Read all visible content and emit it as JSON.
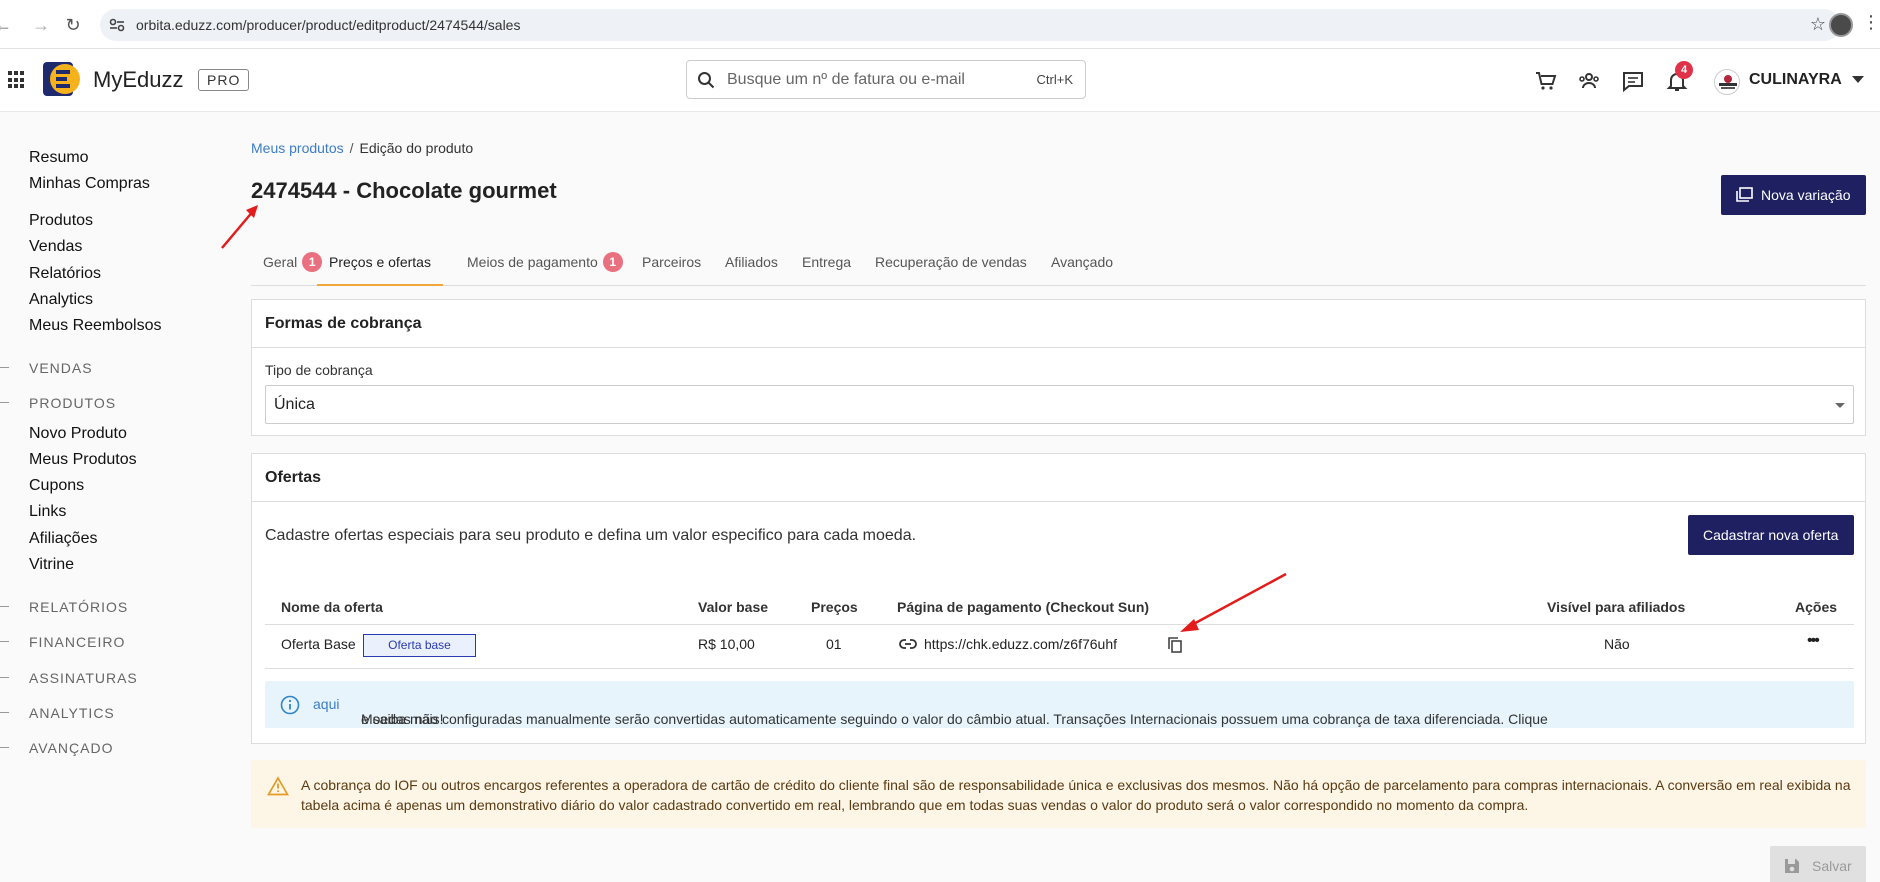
{
  "browser": {
    "url": "orbita.eduzz.com/producer/product/editproduct/2474544/sales"
  },
  "header": {
    "brand": "MyEduzz",
    "plan_badge": "PRO",
    "search_placeholder": "Busque um nº de fatura ou e-mail",
    "search_shortcut": "Ctrl+K",
    "notifications_count": "4",
    "user_name": "CULINAYRA",
    "icons": [
      "cart-icon",
      "users-icon",
      "chat-icon",
      "bell-icon"
    ]
  },
  "sidebar": {
    "top_links": [
      "Resumo",
      "Minhas Compras"
    ],
    "main_links": [
      "Produtos",
      "Vendas",
      "Relatórios",
      "Analytics",
      "Meus Reembolsos"
    ],
    "section_vendas": "VENDAS",
    "section_produtos": "PRODUTOS",
    "produtos_links": [
      "Novo Produto",
      "Meus Produtos",
      "Cupons",
      "Links",
      "Afiliações",
      "Vitrine"
    ],
    "sections_bottom": [
      "RELATÓRIOS",
      "FINANCEIRO",
      "ASSINATURAS",
      "ANALYTICS",
      "AVANÇADO"
    ]
  },
  "breadcrumb": {
    "parent": "Meus produtos",
    "separator": "/",
    "current": "Edição do produto"
  },
  "page": {
    "title": "2474544 - Chocolate gourmet",
    "new_variation_button": "Nova variação"
  },
  "tabs": [
    {
      "label": "Geral",
      "badge": "1"
    },
    {
      "label": "Preços e ofertas",
      "badge": ""
    },
    {
      "label": "Meios de pagamento",
      "badge": "1"
    },
    {
      "label": "Parceiros",
      "badge": ""
    },
    {
      "label": "Afiliados",
      "badge": ""
    },
    {
      "label": "Entrega",
      "badge": ""
    },
    {
      "label": "Recuperação de vendas",
      "badge": ""
    },
    {
      "label": "Avançado",
      "badge": ""
    }
  ],
  "billing": {
    "title": "Formas de cobrança",
    "type_label": "Tipo de cobrança",
    "type_value": "Única"
  },
  "offers": {
    "title": "Ofertas",
    "description": "Cadastre ofertas especiais para seu produto e defina um valor especifico para cada moeda.",
    "new_offer_button": "Cadastrar nova oferta",
    "columns": {
      "name": "Nome da oferta",
      "base_value": "Valor base",
      "prices": "Preços",
      "checkout": "Página de pagamento (Checkout Sun)",
      "visible": "Visível para afiliados",
      "actions": "Ações"
    },
    "rows": [
      {
        "name": "Oferta Base",
        "tag": "Oferta base",
        "base_value": "R$ 10,00",
        "prices": "01",
        "checkout_url": "https://chk.eduzz.com/z6f76uhf",
        "visible": "Não",
        "actions": "•••"
      }
    ],
    "info_text": "Moedas não configuradas manualmente serão convertidas automaticamente seguindo o valor do câmbio atual. Transações Internacionais possuem uma cobrança de taxa diferenciada. Clique",
    "info_link": "aqui",
    "info_suffix": "e saiba mais!"
  },
  "warning": {
    "text": "A cobrança do IOF ou outros encargos referentes a operadora de cartão de crédito do cliente final são de responsabilidade única e exclusivas dos mesmos. Não há opção de parcelamento para compras internacionais. A conversão em real exibida na tabela acima é apenas um demonstrativo diário do valor cadastrado convertido em real, lembrando que em todas suas vendas o valor do produto será o valor correspondido no momento da compra."
  },
  "footer": {
    "save_button": "Salvar"
  },
  "colors": {
    "primary_dark": "#1f2062",
    "tab_active": "#f0a83a",
    "badge_red": "#e9707f",
    "link_blue": "#3d7cc9",
    "annotation_red": "#e31b1b"
  }
}
